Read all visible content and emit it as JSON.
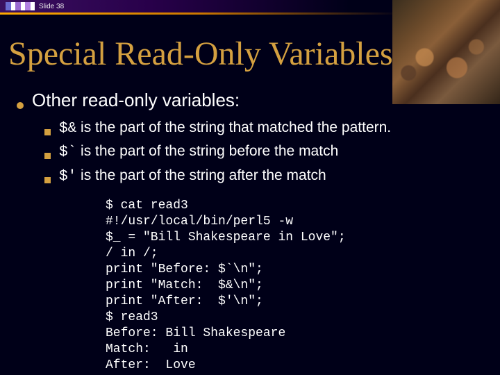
{
  "header": {
    "slide_label": "Slide 38"
  },
  "title": "Special Read-Only Variables",
  "bullets": {
    "l1": "Other read-only variables:",
    "items": [
      {
        "var": "$&",
        "text": " is the part of the string that matched the pattern."
      },
      {
        "var": "$`",
        "text": " is the part of the string before the match"
      },
      {
        "var": "$'",
        "text": " is the part of the string after the match"
      }
    ]
  },
  "code": "$ cat read3\n#!/usr/local/bin/perl5 -w\n$_ = \"Bill Shakespeare in Love\";\n/ in /;\nprint \"Before: $`\\n\";\nprint \"Match:  $&\\n\";\nprint \"After:  $'\\n\";\n$ read3\nBefore: Bill Shakespeare\nMatch:   in \nAfter:  Love"
}
